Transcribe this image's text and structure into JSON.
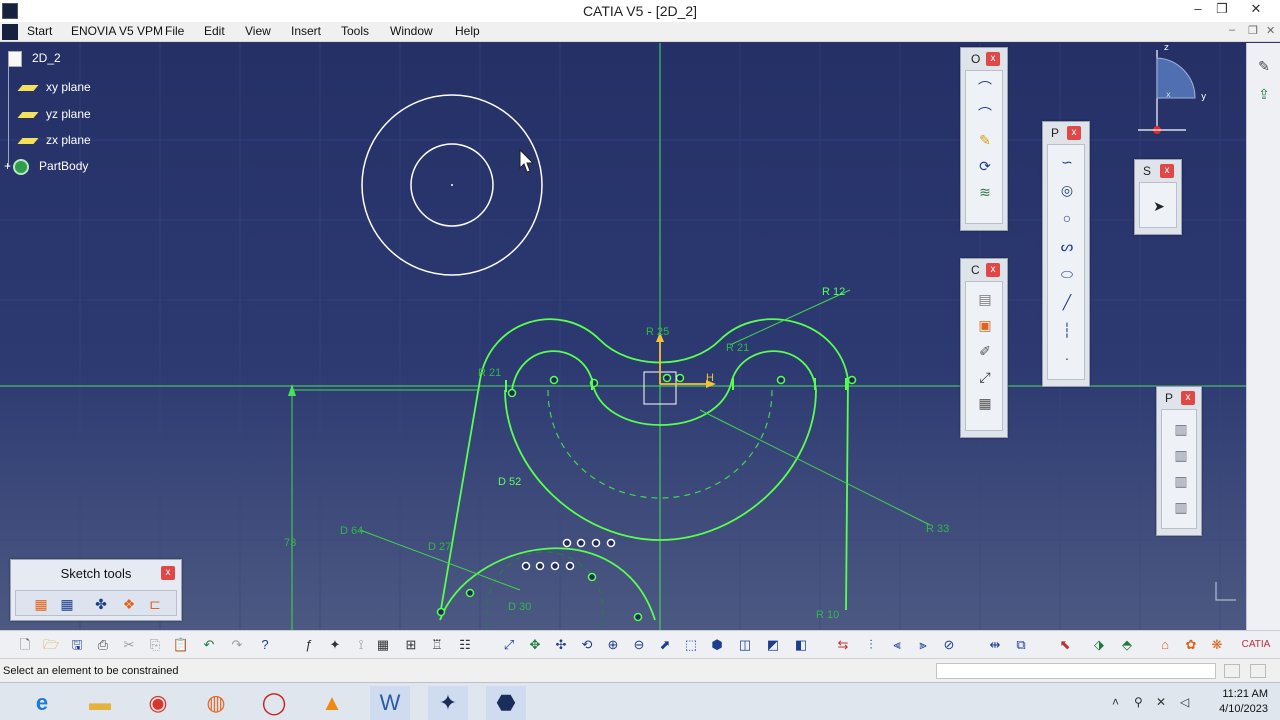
{
  "window": {
    "title": "CATIA V5 - [2D_2]",
    "minimize_icon": "minimize-icon",
    "maximize_icon": "maximize-icon",
    "close_icon": "close-icon"
  },
  "menu": {
    "start": "Start",
    "items": [
      "ENOVIA V5 VPM",
      "File",
      "Edit",
      "View",
      "Insert",
      "Tools",
      "Window",
      "Help"
    ]
  },
  "tree": {
    "root": "2D_2",
    "items": [
      "xy plane",
      "yz plane",
      "zx plane",
      "PartBody"
    ]
  },
  "sketch": {
    "dims": {
      "r12": "R 12",
      "r25": "R 25",
      "r21a": "R 21",
      "r21b": "R 21",
      "h": "H",
      "d52": "D 52",
      "d64": "D 64",
      "d27": "D 27",
      "r33": "R 33",
      "n73": "73",
      "r10": "R 10",
      "d30": "D 30"
    },
    "colors": {
      "geometry": "#59ff4d",
      "construction": "#3fd94a",
      "axis": "#48e05c",
      "circle_white": "#ffffff"
    }
  },
  "toolbars": {
    "profile_o": {
      "title": "O",
      "icons": [
        "arc-icon",
        "arc-icon",
        "pencil-icon",
        "rotate-icon",
        "layers-icon"
      ]
    },
    "profile_p": {
      "title": "P",
      "icons": [
        "spline-icon",
        "circle-icon",
        "circle-icon",
        "curve-icon",
        "ellipse-icon",
        "line-icon",
        "axis-icon",
        "point-icon"
      ]
    },
    "constraint_c": {
      "title": "C",
      "icons": [
        "constraint-icon",
        "constraint-box-icon",
        "clip-icon",
        "fix-icon",
        "grid-icon"
      ]
    },
    "select_s": {
      "title": "S",
      "icons": [
        "cursor-icon"
      ]
    },
    "panel_p2": {
      "title": "P",
      "icons": [
        "sheet-icon",
        "sheet-icon",
        "sheet-icon",
        "sheet-icon"
      ]
    },
    "sketch_tools": {
      "title": "Sketch tools",
      "icons": [
        "grid-icon",
        "snap-grid-icon",
        "construction-icon",
        "geometry-icon",
        "dimension-icon"
      ]
    }
  },
  "statusbar": {
    "prompt": "Select an element to be constrained"
  },
  "taskbar": {
    "apps": [
      "ie-icon",
      "folder-icon",
      "chrome-icon",
      "firefox-icon",
      "opera-icon",
      "vlc-icon",
      "word-icon",
      "catia-icon",
      "catia-alt-icon"
    ],
    "time": "11:21 AM",
    "date": "4/10/2023"
  }
}
